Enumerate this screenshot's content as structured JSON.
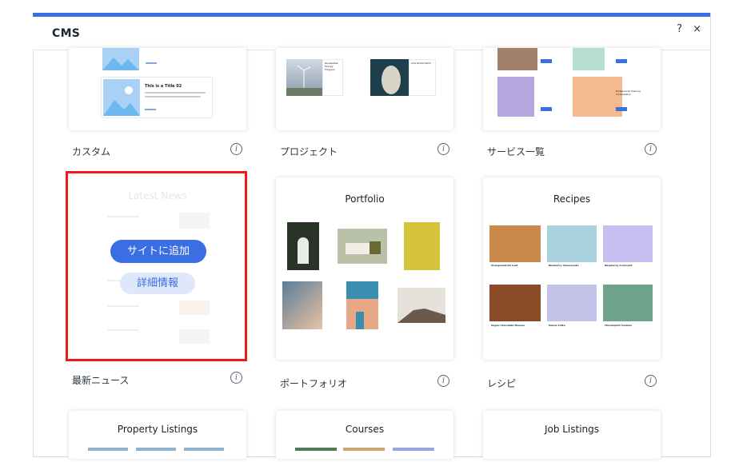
{
  "dialog": {
    "title": "CMS",
    "help_label": "?",
    "close_label": "×",
    "accent_color": "#3b6de3"
  },
  "templates": [
    {
      "label": "カスタム",
      "preview_title": "This is a Title 02",
      "info": "i"
    },
    {
      "label": "プロジェクト",
      "preview_items": [
        "Renewable Energy Program",
        "Arts Global Work"
      ],
      "info": "i"
    },
    {
      "label": "サービス一覧",
      "preview_items": [
        "Professional Training Consultation"
      ],
      "info": "i"
    },
    {
      "label": "最新ニュース",
      "preview_title": "Latest News",
      "info": "i",
      "selected": true
    },
    {
      "label": "ポートフォリオ",
      "preview_title": "Portfolio",
      "info": "i"
    },
    {
      "label": "レシピ",
      "preview_title": "Recipes",
      "info": "i",
      "recipe_cards": [
        "Orangematcha Loaf",
        "Blueberry Cheesecake",
        "Raspberry Croissant",
        "Vegan Chocolate Mousse",
        "Panna Cotta",
        "Thumbprint Cookies"
      ]
    },
    {
      "label": "",
      "preview_title": "Property Listings"
    },
    {
      "label": "",
      "preview_title": "Courses"
    },
    {
      "label": "",
      "preview_title": "Job Listings"
    }
  ],
  "hover_actions": {
    "add_label": "サイトに追加",
    "details_label": "詳細情報"
  },
  "highlight_color": "#ee1b1b"
}
